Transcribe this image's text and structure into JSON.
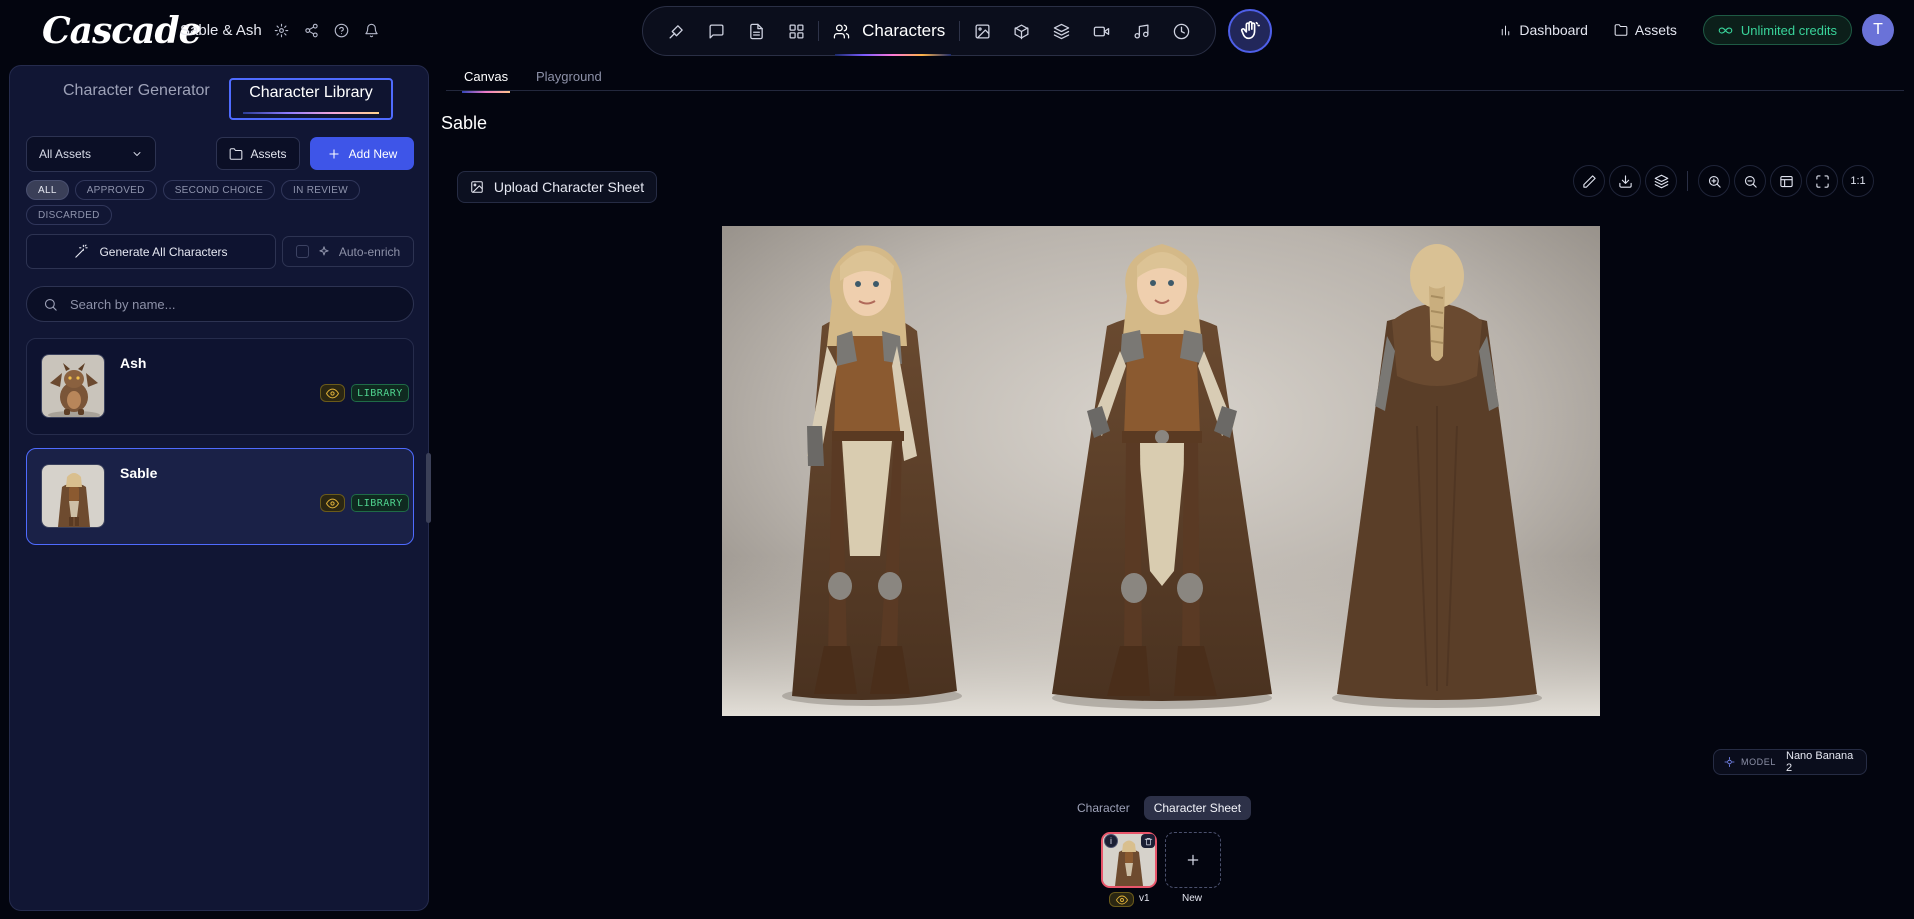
{
  "brand": {
    "logo": "Cascade"
  },
  "project": {
    "title": "Sable & Ash"
  },
  "toolbar": {
    "active_label": "Characters"
  },
  "top_right": {
    "dashboard": "Dashboard",
    "assets": "Assets",
    "credits": "Unlimited credits",
    "avatar_initial": "T"
  },
  "sidebar": {
    "tab_generator": "Character Generator",
    "tab_library": "Character Library",
    "filter_select": "All Assets",
    "assets_button": "Assets",
    "add_new_button": "Add New",
    "chips": [
      "ALL",
      "APPROVED",
      "SECOND CHOICE",
      "IN REVIEW",
      "DISCARDED"
    ],
    "generate_all": "Generate All Characters",
    "auto_enrich": "Auto-enrich",
    "search_placeholder": "Search by name...",
    "characters": [
      {
        "name": "Ash",
        "badge": "LIBRARY"
      },
      {
        "name": "Sable",
        "badge": "LIBRARY"
      }
    ]
  },
  "main": {
    "tab_canvas": "Canvas",
    "tab_playground": "Playground",
    "title": "Sable",
    "upload_button": "Upload Character Sheet",
    "zoom_reset": "1:1",
    "model_label": "MODEL",
    "model_value": "Nano Banana 2",
    "view_character": "Character",
    "view_sheet": "Character Sheet",
    "version_label": "v1",
    "new_label": "New"
  },
  "colors": {
    "accent": "#3e55e8",
    "library_badge": "#4fd48f",
    "credits": "#39d39a",
    "version_border": "#e8566b"
  }
}
